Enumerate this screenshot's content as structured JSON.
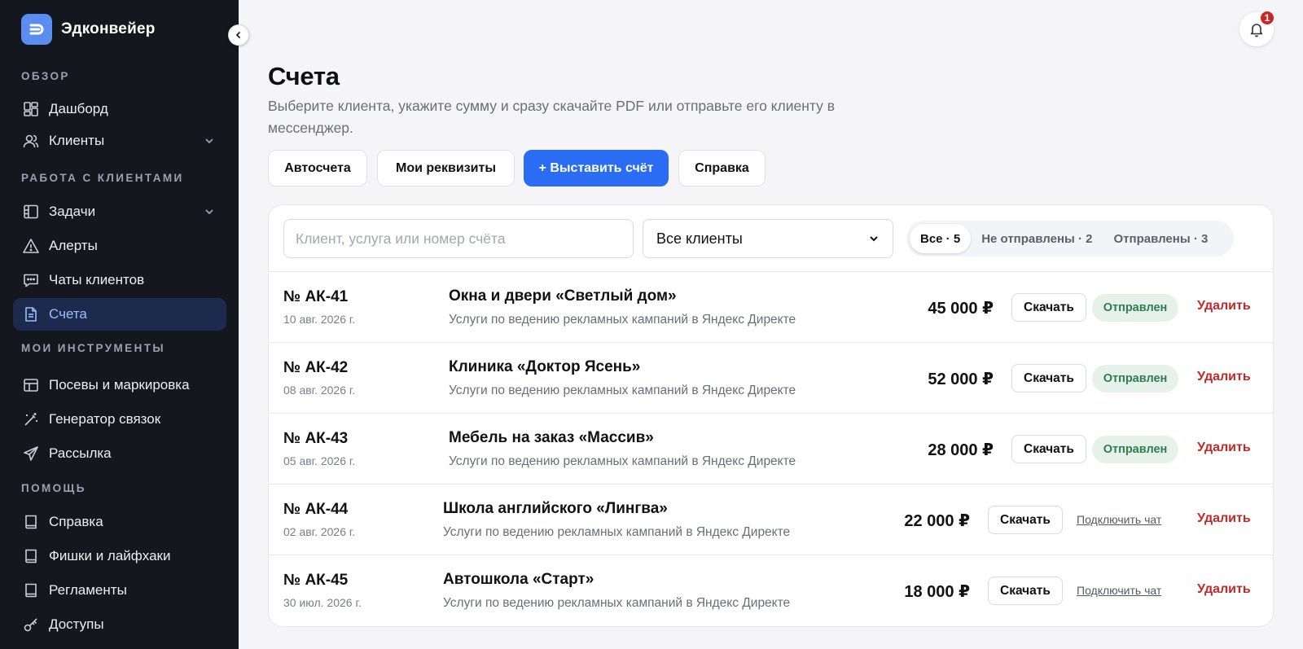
{
  "app": {
    "name": "Эдконвейер"
  },
  "sidebar": {
    "sections": [
      {
        "title": "ОБЗОР"
      },
      {
        "title": "РАБОТА С КЛИЕНТАМИ"
      },
      {
        "title": "МОИ ИНСТРУМЕНТЫ"
      },
      {
        "title": "ПОМОЩЬ"
      }
    ],
    "items": [
      {
        "label": "Дашборд",
        "icon": "dashboard-icon"
      },
      {
        "label": "Клиенты",
        "icon": "users-icon"
      },
      {
        "label": "Задачи",
        "icon": "tasks-icon"
      },
      {
        "label": "Алерты",
        "icon": "alert-icon"
      },
      {
        "label": "Чаты клиентов",
        "icon": "chat-icon"
      },
      {
        "label": "Счета",
        "icon": "document-icon",
        "active": true
      },
      {
        "label": "Посевы и маркировка",
        "icon": "layout-icon"
      },
      {
        "label": "Генератор связок",
        "icon": "wand-icon"
      },
      {
        "label": "Рассылка",
        "icon": "send-icon"
      },
      {
        "label": "Справка",
        "icon": "book-icon"
      },
      {
        "label": "Фишки и лайфхаки",
        "icon": "book-icon"
      },
      {
        "label": "Регламенты",
        "icon": "book-icon"
      },
      {
        "label": "Доступы",
        "icon": "key-icon"
      }
    ]
  },
  "header": {
    "notifications_count": "1"
  },
  "page": {
    "title": "Счета",
    "subtitle": "Выберите клиента, укажите сумму и сразу скачайте PDF или отправьте его клиенту в мессенджер."
  },
  "actions": {
    "auto": "Автосчета",
    "requisites": "Мои реквизиты",
    "create": "+ Выставить счёт",
    "help": "Справка"
  },
  "toolbar": {
    "search_placeholder": "Клиент, услуга или номер счёта",
    "client_select": "Все клиенты",
    "filters": [
      {
        "label": "Все · 5",
        "active": true
      },
      {
        "label": "Не отправлены · 2"
      },
      {
        "label": "Отправлены · 3"
      }
    ]
  },
  "invoices": [
    {
      "number": "№ АК-41",
      "date": "10 авг. 2026 г.",
      "client": "Окна и двери «Светлый дом»",
      "service": "Услуги по ведению рекламных кампаний в Яндекс Директе",
      "amount": "45 000 ₽",
      "download": "Скачать",
      "status": "Отправлен",
      "delete": "Удалить"
    },
    {
      "number": "№ АК-42",
      "date": "08 авг. 2026 г.",
      "client": "Клиника «Доктор Ясень»",
      "service": "Услуги по ведению рекламных кампаний в Яндекс Директе",
      "amount": "52 000 ₽",
      "download": "Скачать",
      "status": "Отправлен",
      "delete": "Удалить"
    },
    {
      "number": "№ АК-43",
      "date": "05 авг. 2026 г.",
      "client": "Мебель на заказ «Массив»",
      "service": "Услуги по ведению рекламных кампаний в Яндекс Директе",
      "amount": "28 000 ₽",
      "download": "Скачать",
      "status": "Отправлен",
      "delete": "Удалить"
    },
    {
      "number": "№ АК-44",
      "date": "02 авг. 2026 г.",
      "client": "Школа английского «Лингва»",
      "service": "Услуги по ведению рекламных кампаний в Яндекс Директе",
      "amount": "22 000 ₽",
      "download": "Скачать",
      "connect": "Подключить чат",
      "delete": "Удалить"
    },
    {
      "number": "№ АК-45",
      "date": "30 июл. 2026 г.",
      "client": "Автошкола «Старт»",
      "service": "Услуги по ведению рекламных кампаний в Яндекс Директе",
      "amount": "18 000 ₽",
      "download": "Скачать",
      "connect": "Подключить чат",
      "delete": "Удалить"
    }
  ],
  "colors": {
    "accent": "#2a6df4",
    "sidebar_bg": "#14171e",
    "danger": "#c62828",
    "success": "#2e7d4f"
  }
}
